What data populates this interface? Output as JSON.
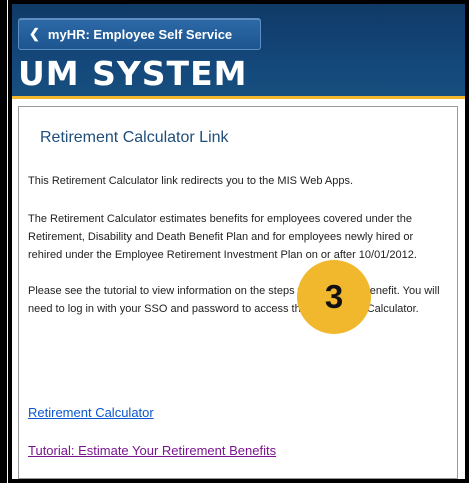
{
  "header": {
    "back_label": "myHR: Employee Self Service",
    "brand": "UM SYSTEM"
  },
  "page": {
    "title": "Retirement Calculator Link",
    "paragraphs": [
      "This Retirement Calculator link redirects you to the MIS Web Apps.",
      "The Retirement Calculator estimates benefits for employees covered under the Retirement, Disability and Death Benefit Plan and for employees newly hired or rehired under the Employee Retirement Investment Plan on or after 10/01/2012.",
      "Please see the tutorial to view information on the steps to estimate a benefit. You will need to log in with your SSO and password to access the Retirement Calculator."
    ],
    "links": {
      "calculator": "Retirement Calculator",
      "tutorial": "Tutorial: Estimate Your Retirement Benefits"
    }
  },
  "callout": {
    "step_number": "3"
  },
  "colors": {
    "header_blue": "#14477a",
    "gold": "#f1b82d",
    "title_blue": "#1f4e79",
    "link_blue": "#0b57d0",
    "link_visited": "#7a1590"
  },
  "icons": {
    "back": "chevron-left-icon"
  }
}
